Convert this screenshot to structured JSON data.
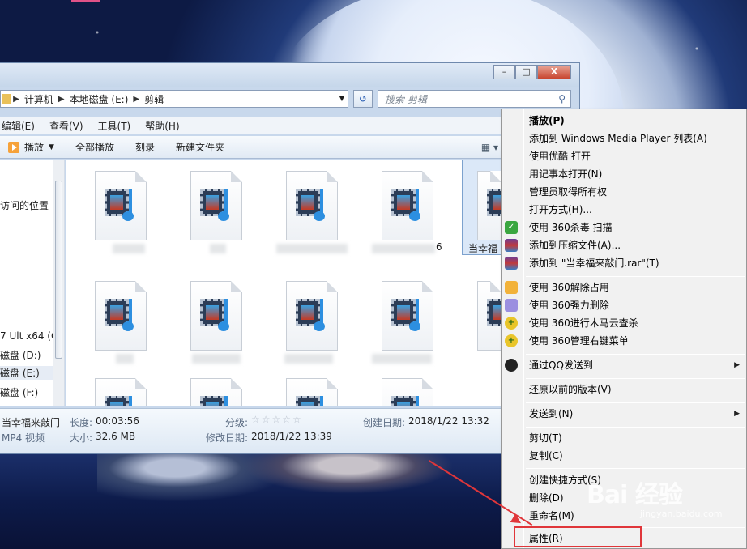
{
  "window": {
    "caption_buttons": {
      "min": "–",
      "max": "□",
      "close": "X"
    },
    "breadcrumb": [
      "计算机",
      "本地磁盘 (E:)",
      "剪辑"
    ],
    "search_placeholder": "搜索 剪辑",
    "menubar": [
      "编辑(E)",
      "查看(V)",
      "工具(T)",
      "帮助(H)"
    ],
    "toolbar": {
      "play": "播放",
      "play_all": "全部播放",
      "burn": "刻录",
      "new_folder": "新建文件夹"
    },
    "nav_items": [
      "访问的位置",
      "7 Ult x64 (C",
      "磁盘 (D:)",
      "磁盘 (E:)",
      "磁盘 (F:)"
    ],
    "selected_file_label": "当幸福",
    "partial_file_label": "6",
    "details": {
      "name": "当幸福来敲门",
      "type": "MP4 视频",
      "length_label": "长度:",
      "length": "00:03:56",
      "size_label": "大小:",
      "size": "32.6 MB",
      "rating_label": "分级:",
      "rating_stars": "☆☆☆☆☆",
      "created_label": "创建日期:",
      "created": "2018/1/22 13:32",
      "modified_label": "修改日期:",
      "modified": "2018/1/22 13:39"
    }
  },
  "context_menu": {
    "items": [
      "播放(P)",
      "添加到 Windows Media Player 列表(A)",
      "使用优酷 打开",
      "用记事本打开(N)",
      "管理员取得所有权",
      "打开方式(H)...",
      "使用 360杀毒 扫描",
      "添加到压缩文件(A)...",
      "添加到 \"当幸福来敲门.rar\"(T)",
      "使用 360解除占用",
      "使用 360强力删除",
      "使用 360进行木马云查杀",
      "使用 360管理右键菜单",
      "通过QQ发送到",
      "还原以前的版本(V)",
      "发送到(N)",
      "剪切(T)",
      "复制(C)",
      "创建快捷方式(S)",
      "删除(D)",
      "重命名(M)",
      "属性(R)"
    ]
  },
  "watermark": {
    "brand": "Bai 经验",
    "sub": "jingyan.baidu.com"
  },
  "colors": {
    "highlight": "#e0363a",
    "accent": "#2d8fe0"
  }
}
